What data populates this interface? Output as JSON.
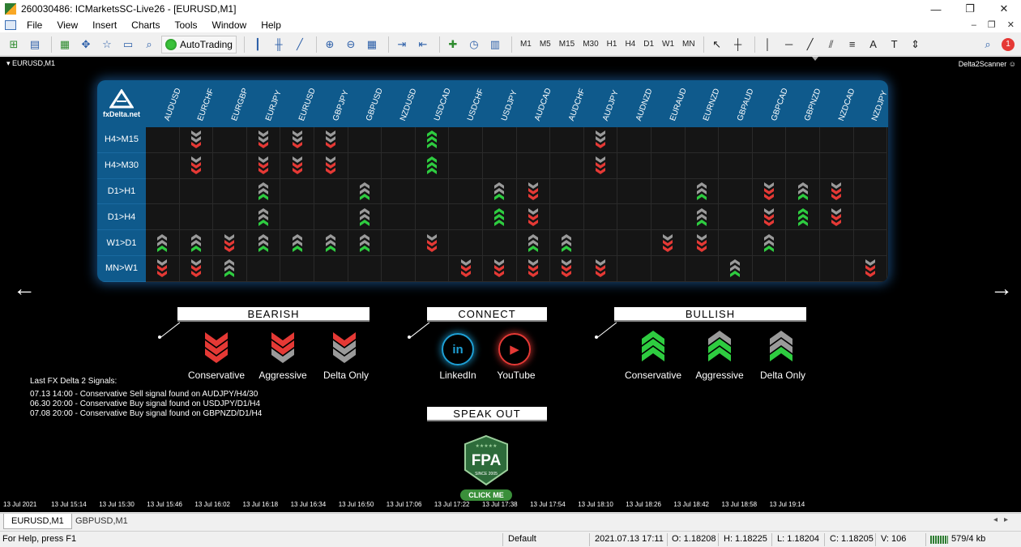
{
  "window": {
    "title": "260030486: ICMarketsSC-Live26 - [EURUSD,M1]"
  },
  "menu": [
    "File",
    "View",
    "Insert",
    "Charts",
    "Tools",
    "Window",
    "Help"
  ],
  "toolbar": {
    "autotrading_label": "AutoTrading",
    "timeframes": [
      "M1",
      "M5",
      "M15",
      "M30",
      "H1",
      "H4",
      "D1",
      "W1",
      "MN"
    ],
    "notification_count": "1"
  },
  "chart": {
    "symbol_label": "EURUSD,M1",
    "indicator_label": "Delta2Scanner",
    "logo_text": "fxDelta.net",
    "pairs": [
      "AUDUSD",
      "EURCHF",
      "EURGBP",
      "EURJPY",
      "EURUSD",
      "GBPJPY",
      "GBPUSD",
      "NZDUSD",
      "USDCAD",
      "USDCHF",
      "USDJPY",
      "AUDCAD",
      "AUDCHF",
      "AUDJPY",
      "AUDNZD",
      "EURAUD",
      "EURNZD",
      "GBPAUD",
      "GBPCAD",
      "GBPNZD",
      "NZDCAD",
      "NZDJPY"
    ],
    "rows": [
      {
        "label": "H4>M15",
        "cells": [
          "",
          "sg",
          "",
          "sg",
          "sg",
          "sg",
          "",
          "",
          "bgc",
          "",
          "",
          "",
          "",
          "sg",
          "",
          "",
          "",
          "",
          "",
          "",
          "",
          ""
        ]
      },
      {
        "label": "H4>M30",
        "cells": [
          "",
          "sr",
          "",
          "sr",
          "sr",
          "sr",
          "",
          "",
          "bgc",
          "",
          "",
          "",
          "",
          "sr",
          "",
          "",
          "",
          "",
          "",
          "",
          "",
          ""
        ]
      },
      {
        "label": "D1>H1",
        "cells": [
          "",
          "",
          "",
          "bg",
          "",
          "",
          "bg",
          "",
          "",
          "",
          "bg",
          "sr",
          "",
          "",
          "",
          "",
          "bg",
          "",
          "sr",
          "bg",
          "sr",
          ""
        ]
      },
      {
        "label": "D1>H4",
        "cells": [
          "",
          "",
          "",
          "bg",
          "",
          "",
          "bg",
          "",
          "",
          "",
          "bgc",
          "sr",
          "",
          "",
          "",
          "",
          "bg",
          "",
          "sr",
          "bgc",
          "sr",
          ""
        ]
      },
      {
        "label": "W1>D1",
        "cells": [
          "bg",
          "bg",
          "sr",
          "bg",
          "bg",
          "bg",
          "bg",
          "",
          "sr",
          "",
          "",
          "bg",
          "bg",
          "",
          "",
          "sr",
          "sr",
          "",
          "bg",
          "",
          "",
          ""
        ]
      },
      {
        "label": "MN>W1",
        "cells": [
          "sr",
          "sr",
          "bg",
          "",
          "",
          "",
          "",
          "",
          "",
          "sr",
          "sr",
          "sr",
          "sr",
          "sr",
          "",
          "",
          "",
          "bg",
          "",
          "",
          "",
          "sr"
        ]
      }
    ],
    "legend": {
      "bearish_title": "BEARISH",
      "connect_title": "CONNECT",
      "bullish_title": "BULLISH",
      "speak_title": "SPEAK OUT",
      "conservative": "Conservative",
      "aggressive": "Aggressive",
      "delta_only": "Delta Only",
      "linkedin": "LinkedIn",
      "youtube": "YouTube",
      "linkedin_icon_text": "in",
      "youtube_icon_text": "▶"
    },
    "signals": {
      "header": "Last FX Delta 2 Signals:",
      "lines": [
        "07.13 14:00 - Conservative Sell signal found on AUDJPY/H4/30",
        "06.30 20:00 - Conservative Buy signal found on USDJPY/D1/H4",
        "07.08 20:00 - Conservative Buy signal found on GBPNZD/D1/H4"
      ]
    },
    "fpa": {
      "badge_text": "FPA",
      "since_text": "SINCE 2005",
      "click_label": "CLICK ME"
    },
    "time_axis": [
      "13 Jul 2021",
      "13 Jul 15:14",
      "13 Jul 15:30",
      "13 Jul 15:46",
      "13 Jul 16:02",
      "13 Jul 16:18",
      "13 Jul 16:34",
      "13 Jul 16:50",
      "13 Jul 17:06",
      "13 Jul 17:22",
      "13 Jul 17:38",
      "13 Jul 17:54",
      "13 Jul 18:10",
      "13 Jul 18:26",
      "13 Jul 18:42",
      "13 Jul 18:58",
      "13 Jul 19:14"
    ]
  },
  "tabs": [
    "EURUSD,M1",
    "GBPUSD,M1"
  ],
  "status": {
    "help": "For Help, press F1",
    "profile": "Default",
    "datetime": "2021.07.13 17:11",
    "open": "O: 1.18208",
    "high": "H: 1.18225",
    "low": "L: 1.18204",
    "close": "C: 1.18205",
    "volume": "V: 106",
    "traffic": "579/4 kb"
  },
  "colors": {
    "bear": "#e53935",
    "bull": "#2ecc40",
    "neutral": "#9a9a9a",
    "grid_header": "#0f5a8c"
  }
}
